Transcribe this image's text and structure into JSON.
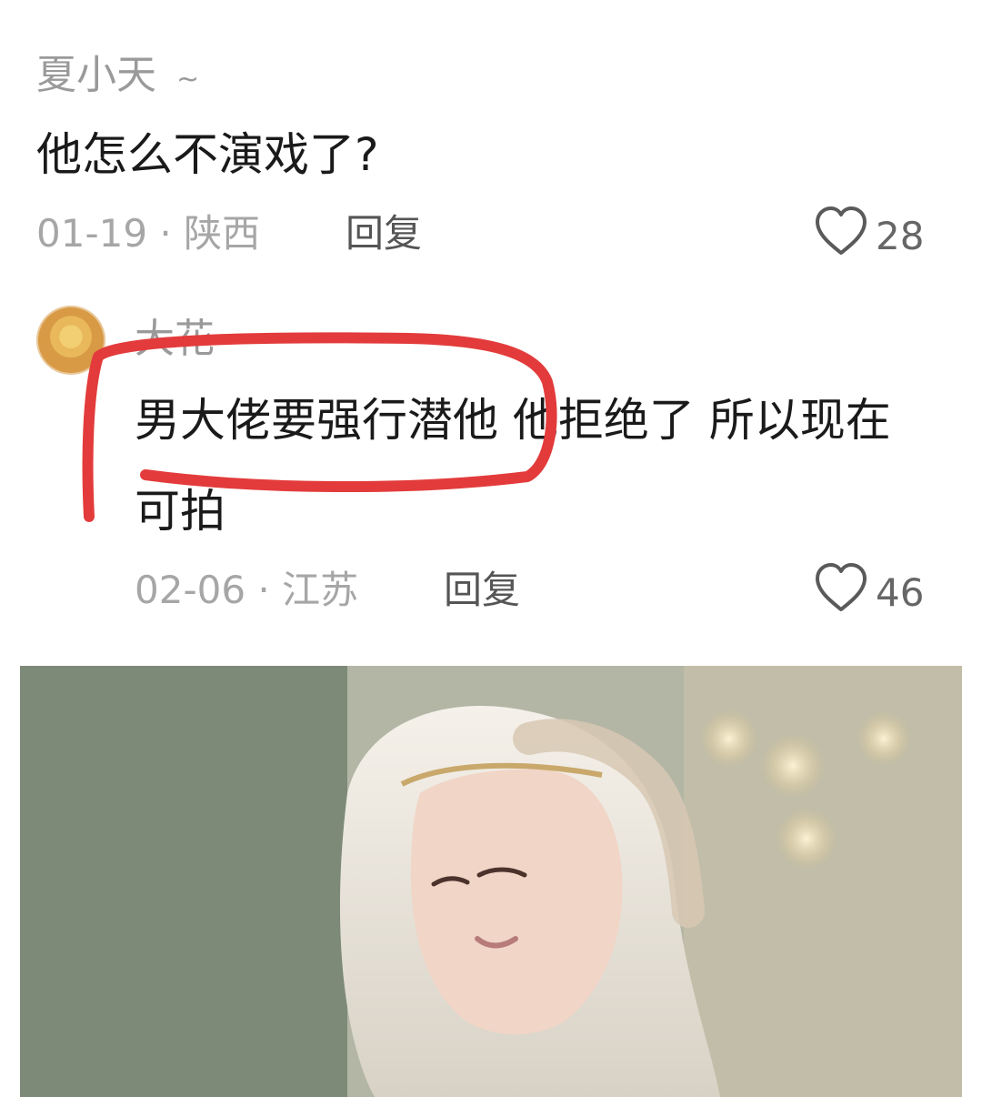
{
  "comments": [
    {
      "username": "夏小天",
      "username_suffix": "~",
      "text": "他怎么不演戏了?",
      "date": "01-19",
      "location": "陕西",
      "reply_label": "回复",
      "likes": "28"
    },
    {
      "username": "大花",
      "text_line1": "男大佬要强行潜他 他拒绝了 所以现在",
      "text_line2": "可拍",
      "date": "02-06",
      "location": "江苏",
      "reply_label": "回复",
      "likes": "46"
    }
  ],
  "colors": {
    "highlight_stroke": "#e03131",
    "muted_text": "#a6a6a6",
    "body_text": "#1a1a1a"
  },
  "icons": [
    "heart-icon",
    "avatar"
  ]
}
